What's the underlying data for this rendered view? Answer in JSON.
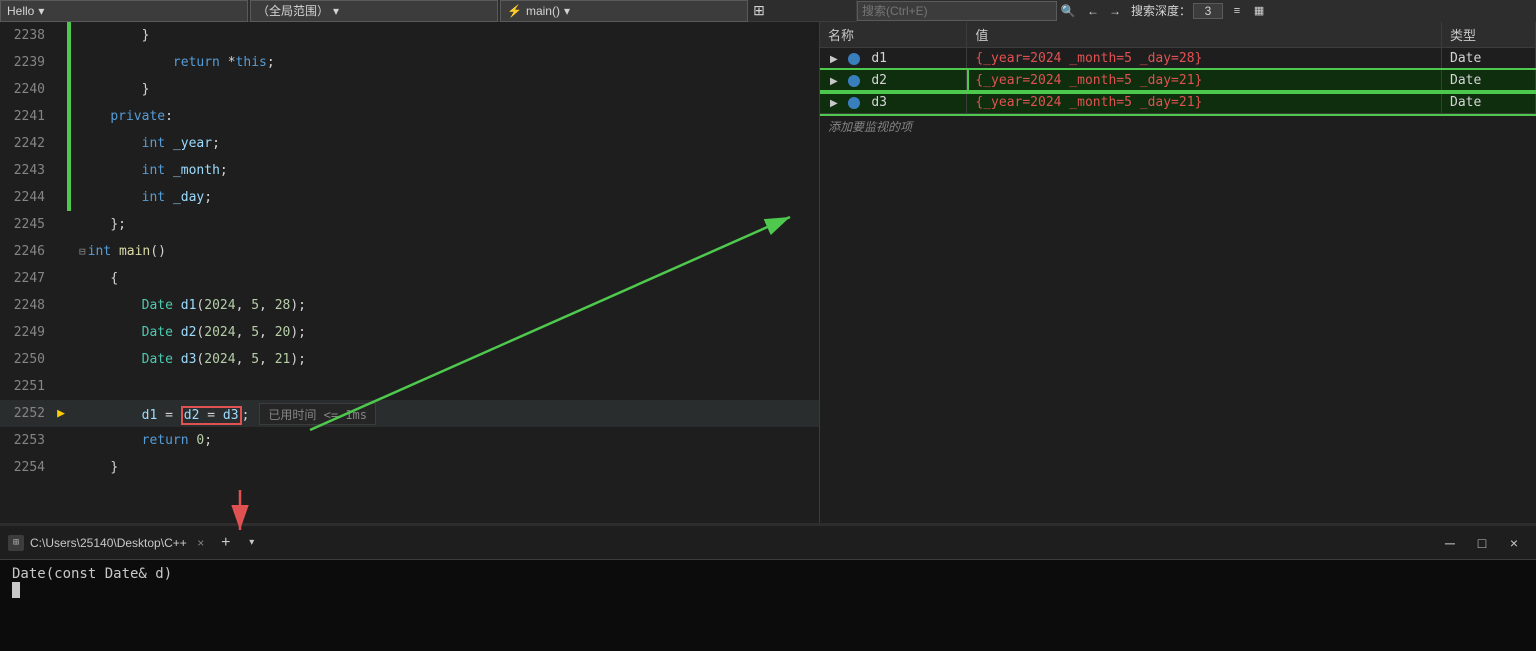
{
  "toolbar": {
    "hello_label": "Hello",
    "hello_arrow": "▾",
    "scope_label": "（全局范围）",
    "scope_arrow": "▾",
    "func_prefix": "⚡",
    "func_label": "main()",
    "func_arrow": "▾",
    "pin_icon": "📌",
    "search_placeholder": "搜索(Ctrl+E)",
    "search_icon": "🔍",
    "nav_back": "←",
    "nav_fwd": "→",
    "depth_label": "搜索深度：",
    "depth_value": "3",
    "tb_icon1": "≡",
    "tb_icon2": "▦"
  },
  "code": {
    "lines": [
      {
        "num": "2238",
        "indent": 3,
        "content": "}",
        "type": "plain",
        "has_green_bar": true
      },
      {
        "num": "2239",
        "indent": 4,
        "content": "return *this;",
        "type": "mixed",
        "has_green_bar": true
      },
      {
        "num": "2240",
        "indent": 3,
        "content": "}",
        "type": "plain",
        "has_green_bar": true
      },
      {
        "num": "2241",
        "indent": 2,
        "content": "private:",
        "type": "keyword",
        "has_green_bar": true
      },
      {
        "num": "2242",
        "indent": 3,
        "content": "int _year;",
        "type": "mixed",
        "has_green_bar": true
      },
      {
        "num": "2243",
        "indent": 3,
        "content": "int _month;",
        "type": "mixed",
        "has_green_bar": true
      },
      {
        "num": "2244",
        "indent": 3,
        "content": "int _day;",
        "type": "mixed",
        "has_green_bar": true
      },
      {
        "num": "2245",
        "indent": 2,
        "content": "};",
        "type": "plain",
        "has_green_bar": false
      },
      {
        "num": "2246",
        "indent": 0,
        "content": "int main()",
        "type": "func_def",
        "has_green_bar": false,
        "collapsed": true
      },
      {
        "num": "2247",
        "indent": 1,
        "content": "{",
        "type": "plain",
        "has_green_bar": false
      },
      {
        "num": "2248",
        "indent": 2,
        "content": "Date d1(2024, 5, 28);",
        "type": "code",
        "has_green_bar": false
      },
      {
        "num": "2249",
        "indent": 2,
        "content": "Date d2(2024, 5, 20);",
        "type": "code",
        "has_green_bar": false
      },
      {
        "num": "2250",
        "indent": 2,
        "content": "Date d3(2024, 5, 21);",
        "type": "code",
        "has_green_bar": false
      },
      {
        "num": "2251",
        "indent": 0,
        "content": "",
        "type": "plain",
        "has_green_bar": false
      },
      {
        "num": "2252",
        "indent": 2,
        "content": "d1 = d2 = d3;",
        "type": "assign",
        "has_green_bar": false,
        "current": true,
        "exec_time": "已用时间 <= 1ms"
      },
      {
        "num": "2253",
        "indent": 2,
        "content": "return 0;",
        "type": "return",
        "has_green_bar": false
      },
      {
        "num": "2254",
        "indent": 1,
        "content": "}",
        "type": "plain",
        "has_green_bar": false
      }
    ]
  },
  "watch": {
    "col_name": "名称",
    "col_value": "值",
    "col_type": "类型",
    "rows": [
      {
        "name": "d1",
        "value": "{_year=2024 _month=5 _day=28}",
        "type": "Date",
        "highlighted": false
      },
      {
        "name": "d2",
        "value": "{_year=2024 _month=5 _day=21}",
        "type": "Date",
        "highlighted": true
      },
      {
        "name": "d3",
        "value": "{_year=2024 _month=5 _day=21}",
        "type": "Date",
        "highlighted": true
      }
    ],
    "add_text": "添加要监视的项"
  },
  "terminal": {
    "icon": "⊞",
    "title": "C:\\Users\\25140\\Desktop\\C++",
    "close_icon": "×",
    "add_icon": "+",
    "dropdown_icon": "▾",
    "minimize_icon": "─",
    "maximize_icon": "□",
    "close_win_icon": "×",
    "content": "Date(const Date& d)",
    "cursor": ""
  }
}
